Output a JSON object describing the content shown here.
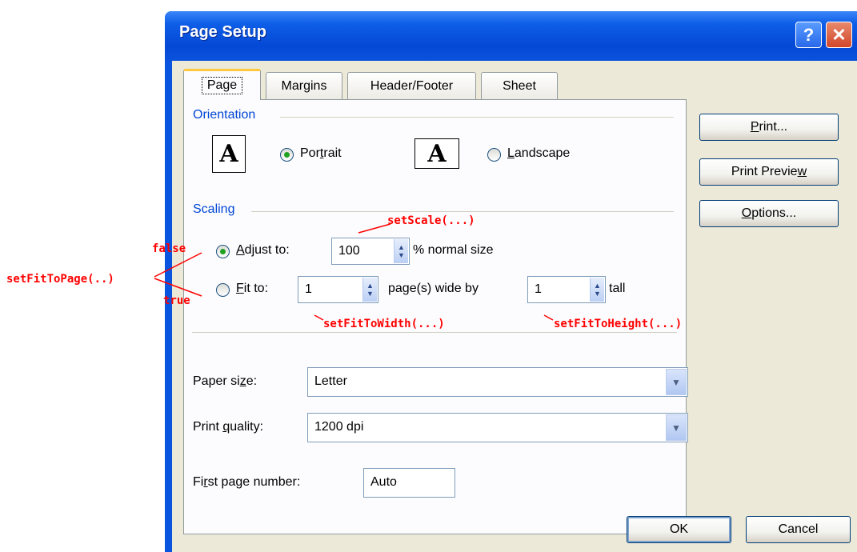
{
  "window": {
    "title": "Page Setup",
    "help_glyph": "?",
    "close_glyph": "✕"
  },
  "tabs": [
    "Page",
    "Margins",
    "Header/Footer",
    "Sheet"
  ],
  "orientation": {
    "title": "Orientation",
    "icon_glyph": "A",
    "portrait": {
      "label_pre": "Por",
      "label_key": "t",
      "label_post": "rait",
      "checked": true
    },
    "landscape": {
      "label_pre": "",
      "label_key": "L",
      "label_post": "andscape",
      "checked": false
    }
  },
  "scaling": {
    "title": "Scaling",
    "adjust": {
      "label_pre": "",
      "label_key": "A",
      "label_post": "djust to:",
      "value": "100",
      "suffix": "% normal size",
      "checked": true
    },
    "fit": {
      "label_pre": "",
      "label_key": "F",
      "label_post": "it to:",
      "wide_value": "1",
      "wide_suffix": "page(s) wide by",
      "tall_value": "1",
      "tall_suffix": "tall",
      "checked": false
    }
  },
  "paper_size": {
    "label_pre": "Paper si",
    "label_key": "z",
    "label_post": "e:",
    "value": "Letter"
  },
  "print_quality": {
    "label_pre": "Print ",
    "label_key": "q",
    "label_post": "uality:",
    "value": "1200 dpi"
  },
  "first_page_number": {
    "label_pre": "Fi",
    "label_key": "r",
    "label_post": "st page number:",
    "value": "Auto"
  },
  "side_buttons": {
    "print": {
      "pre": "",
      "key": "P",
      "post": "rint..."
    },
    "preview": {
      "pre": "Print Previe",
      "key": "w",
      "post": ""
    },
    "options": {
      "pre": "",
      "key": "O",
      "post": "ptions..."
    }
  },
  "footer_buttons": {
    "ok": "OK",
    "cancel": "Cancel"
  },
  "annotations": {
    "set_scale": "setScale(...)",
    "set_fit_to_page": "setFitToPage(..)",
    "false_label": "false",
    "true_label": "true",
    "set_fit_to_width": "setFitToWidth(...)",
    "set_fit_to_height": "setFitToHeight(...)",
    "color": "#ff0000"
  }
}
